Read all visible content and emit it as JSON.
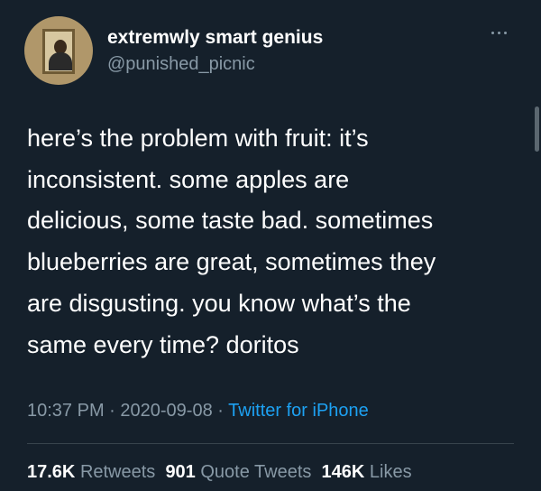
{
  "user": {
    "display_name": "extremwly smart genius",
    "handle": "@punished_picnic"
  },
  "tweet": {
    "lines": [
      "here’s the problem with fruit: it’s",
      "inconsistent. some apples are",
      "delicious, some taste bad. sometimes",
      "blueberries are great, sometimes they",
      "are disgusting. you know what’s the",
      "same every time? doritos"
    ]
  },
  "meta": {
    "time": "10:37 PM",
    "date": "2020-09-08",
    "separator": "·",
    "source": "Twitter for iPhone"
  },
  "stats": {
    "retweets_count": "17.6K",
    "retweets_label": "Retweets",
    "quotes_count": "901",
    "quotes_label": "Quote Tweets",
    "likes_count": "146K",
    "likes_label": "Likes"
  },
  "icons": {
    "more": "more-horizontal-icon"
  },
  "colors": {
    "background": "#15202b",
    "text": "#ffffff",
    "secondary": "#8899a6",
    "link": "#1da1f2",
    "divider": "#38444d"
  }
}
